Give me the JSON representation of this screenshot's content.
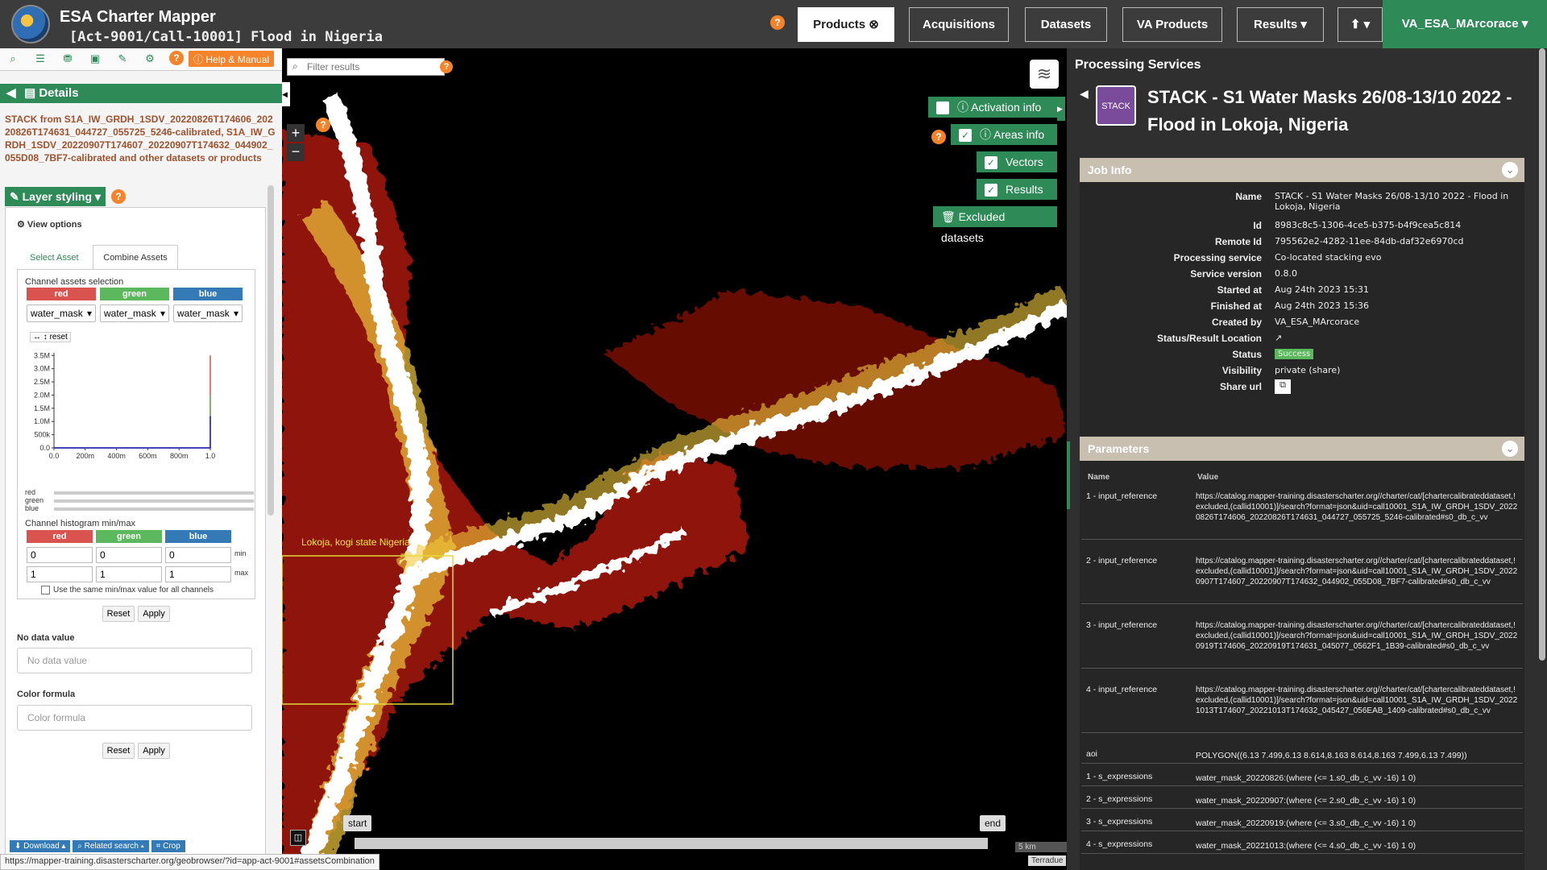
{
  "app": {
    "title": "ESA Charter Mapper",
    "subtitle": "[Act-9001/Call-10001] Flood in Nigeria"
  },
  "nav": {
    "products": "Products",
    "acquisitions": "Acquisitions",
    "datasets": "Datasets",
    "va_products": "VA Products",
    "results": "Results",
    "user": "VA_ESA_MArcorace"
  },
  "left": {
    "help_manual": "Help & Manual",
    "details": "Details",
    "description": "STACK from S1A_IW_GRDH_1SDV_20220826T174606_20220826T174631_044727_055725_5246-calibrated, S1A_IW_GRDH_1SDV_20220907T174607_20220907T174632_044902_055D08_7BF7-calibrated and other datasets or products",
    "layer_styling": "Layer styling",
    "view_options": "View options",
    "tab_select": "Select Asset",
    "tab_combine": "Combine Assets",
    "channel_assets": "Channel assets selection",
    "red": "red",
    "green": "green",
    "blue": "blue",
    "asset_value": "water_mask",
    "reset": "reset",
    "histogram_title": "Channel histogram min/max",
    "min_label": "min",
    "max_label": "max",
    "min_val": "0",
    "max_val": "1",
    "same_minmax": "Use the same min/max value for all channels",
    "btn_reset": "Reset",
    "btn_apply": "Apply",
    "no_data_label": "No data value",
    "no_data_placeholder": "No data value",
    "color_formula_label": "Color formula",
    "color_formula_placeholder": "Color formula",
    "download": "Download",
    "related": "Related search",
    "crop": "Crop"
  },
  "chart_data": {
    "type": "line",
    "title": "",
    "x_ticks": [
      "0.0",
      "200m",
      "400m",
      "600m",
      "800m",
      "1.0"
    ],
    "y_ticks": [
      "0.0",
      "500k",
      "1.0M",
      "1.5M",
      "2.0M",
      "2.5M",
      "3.0M",
      "3.5M"
    ],
    "xlim": [
      0,
      1
    ],
    "ylim": [
      0,
      3600000
    ],
    "series": [
      {
        "name": "red",
        "x": [
          0,
          1,
          1
        ],
        "y": [
          0,
          0,
          3500000
        ]
      },
      {
        "name": "green",
        "x": [
          0,
          1,
          1
        ],
        "y": [
          0,
          0,
          2000000
        ]
      },
      {
        "name": "blue",
        "x": [
          0,
          1,
          1
        ],
        "y": [
          0,
          0,
          1200000
        ]
      }
    ]
  },
  "map": {
    "filter_placeholder": "Filter results",
    "activation_info": "Activation info",
    "areas_info": "Areas info",
    "vectors": "Vectors",
    "results": "Results",
    "excluded": "Excluded datasets",
    "place_label": "Lokoja, kogi state Nigeria",
    "start": "start",
    "end": "end",
    "scale": "5 km",
    "attribution": "Terradue"
  },
  "right": {
    "section_title": "Processing Services",
    "badge": "STACK",
    "job_title": "STACK - S1 Water Masks 26/08-13/10 2022 - Flood in Lokoja, Nigeria",
    "job_info": "Job Info",
    "fields": [
      {
        "k": "Name",
        "v": "STACK - S1 Water Masks 26/08-13/10 2022 - Flood in Lokoja, Nigeria"
      },
      {
        "k": "Id",
        "v": "8983c8c5-1306-4ce5-b375-b4f9cea5c814"
      },
      {
        "k": "Remote Id",
        "v": "795562e2-4282-11ee-84db-daf32e6970cd"
      },
      {
        "k": "Processing service",
        "v": "Co-located stacking evo"
      },
      {
        "k": "Service version",
        "v": "0.8.0"
      },
      {
        "k": "Started at",
        "v": "Aug 24th 2023 15:31"
      },
      {
        "k": "Finished at",
        "v": "Aug 24th 2023 15:36"
      },
      {
        "k": "Created by",
        "v": "VA_ESA_MArcorace"
      },
      {
        "k": "Status/Result Location",
        "v": ""
      },
      {
        "k": "Status",
        "v": "Success"
      },
      {
        "k": "Visibility",
        "v": "private (share)"
      },
      {
        "k": "Share url",
        "v": ""
      }
    ],
    "parameters": "Parameters",
    "col_name": "Name",
    "col_value": "Value",
    "params": [
      {
        "n": "1 - input_reference",
        "v": "https://catalog.mapper-training.disasterscharter.org//charter/cat/[chartercalibrateddataset,!excluded,(callid10001)]/search?format=json&uid=call10001_S1A_IW_GRDH_1SDV_20220826T174606_20220826T174631_044727_055725_5246-calibrated#s0_db_c_vv"
      },
      {
        "n": "2 - input_reference",
        "v": "https://catalog.mapper-training.disasterscharter.org//charter/cat/[chartercalibrateddataset,!excluded,(callid10001)]/search?format=json&uid=call10001_S1A_IW_GRDH_1SDV_20220907T174607_20220907T174632_044902_055D08_7BF7-calibrated#s0_db_c_vv"
      },
      {
        "n": "3 - input_reference",
        "v": "https://catalog.mapper-training.disasterscharter.org//charter/cat/[chartercalibrateddataset,!excluded,(callid10001)]/search?format=json&uid=call10001_S1A_IW_GRDH_1SDV_20220919T174606_20220919T174631_045077_0562F1_1B39-calibrated#s0_db_c_vv"
      },
      {
        "n": "4 - input_reference",
        "v": "https://catalog.mapper-training.disasterscharter.org//charter/cat/[chartercalibrateddataset,!excluded,(callid10001)]/search?format=json&uid=call10001_S1A_IW_GRDH_1SDV_20221013T174607_20221013T174632_045427_056EAB_1409-calibrated#s0_db_c_vv"
      },
      {
        "n": "aoi",
        "v": "POLYGON((6.13 7.499,6.13 8.614,8.163 8.614,8.163 7.499,6.13 7.499))"
      },
      {
        "n": "1 - s_expressions",
        "v": "water_mask_20220826:(where (<= 1.s0_db_c_vv -16) 1 0)"
      },
      {
        "n": "2 - s_expressions",
        "v": "water_mask_20220907:(where (<= 2.s0_db_c_vv -16) 1 0)"
      },
      {
        "n": "3 - s_expressions",
        "v": "water_mask_20220919:(where (<= 3.s0_db_c_vv -16) 1 0)"
      },
      {
        "n": "4 - s_expressions",
        "v": "water_mask_20221013:(where (<= 4.s0_db_c_vv -16) 1 0)"
      }
    ]
  },
  "status_url": "https://mapper-training.disasterscharter.org/geobrowser/?id=app-act-9001#assetsCombination"
}
